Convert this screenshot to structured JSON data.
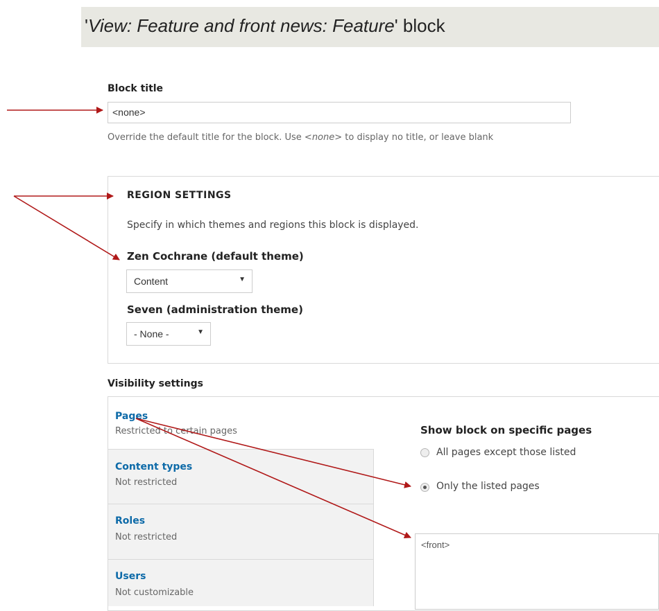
{
  "header": {
    "title_prefix": "'",
    "title_view_name": "View: Feature and front news: Feature",
    "title_suffix": "' block"
  },
  "block_title": {
    "label": "Block title",
    "value": "<none>",
    "description_before": "Override the default title for the block. Use ",
    "description_code": "<none>",
    "description_after": " to display no title, or leave blank"
  },
  "region_settings": {
    "legend": "REGION SETTINGS",
    "help": "Specify in which themes and regions this block is displayed.",
    "themes": [
      {
        "label": "Zen Cochrane (default theme)",
        "selected": "Content"
      },
      {
        "label": "Seven (administration theme)",
        "selected": "- None -"
      }
    ]
  },
  "visibility": {
    "heading": "Visibility settings",
    "tabs": [
      {
        "title": "Pages",
        "summary": "Restricted to certain pages",
        "active": true
      },
      {
        "title": "Content types",
        "summary": "Not restricted",
        "active": false
      },
      {
        "title": "Roles",
        "summary": "Not restricted",
        "active": false
      },
      {
        "title": "Users",
        "summary": "Not customizable",
        "active": false
      }
    ],
    "pages_pane": {
      "heading": "Show block on specific pages",
      "options": [
        {
          "label": "All pages except those listed",
          "checked": false
        },
        {
          "label": "Only the listed pages",
          "checked": true
        }
      ],
      "pages_value": "<front>"
    }
  },
  "colors": {
    "annotation_arrow": "#b01818",
    "tab_link": "#0d6aa8",
    "title_bar": "#e8e8e2"
  }
}
